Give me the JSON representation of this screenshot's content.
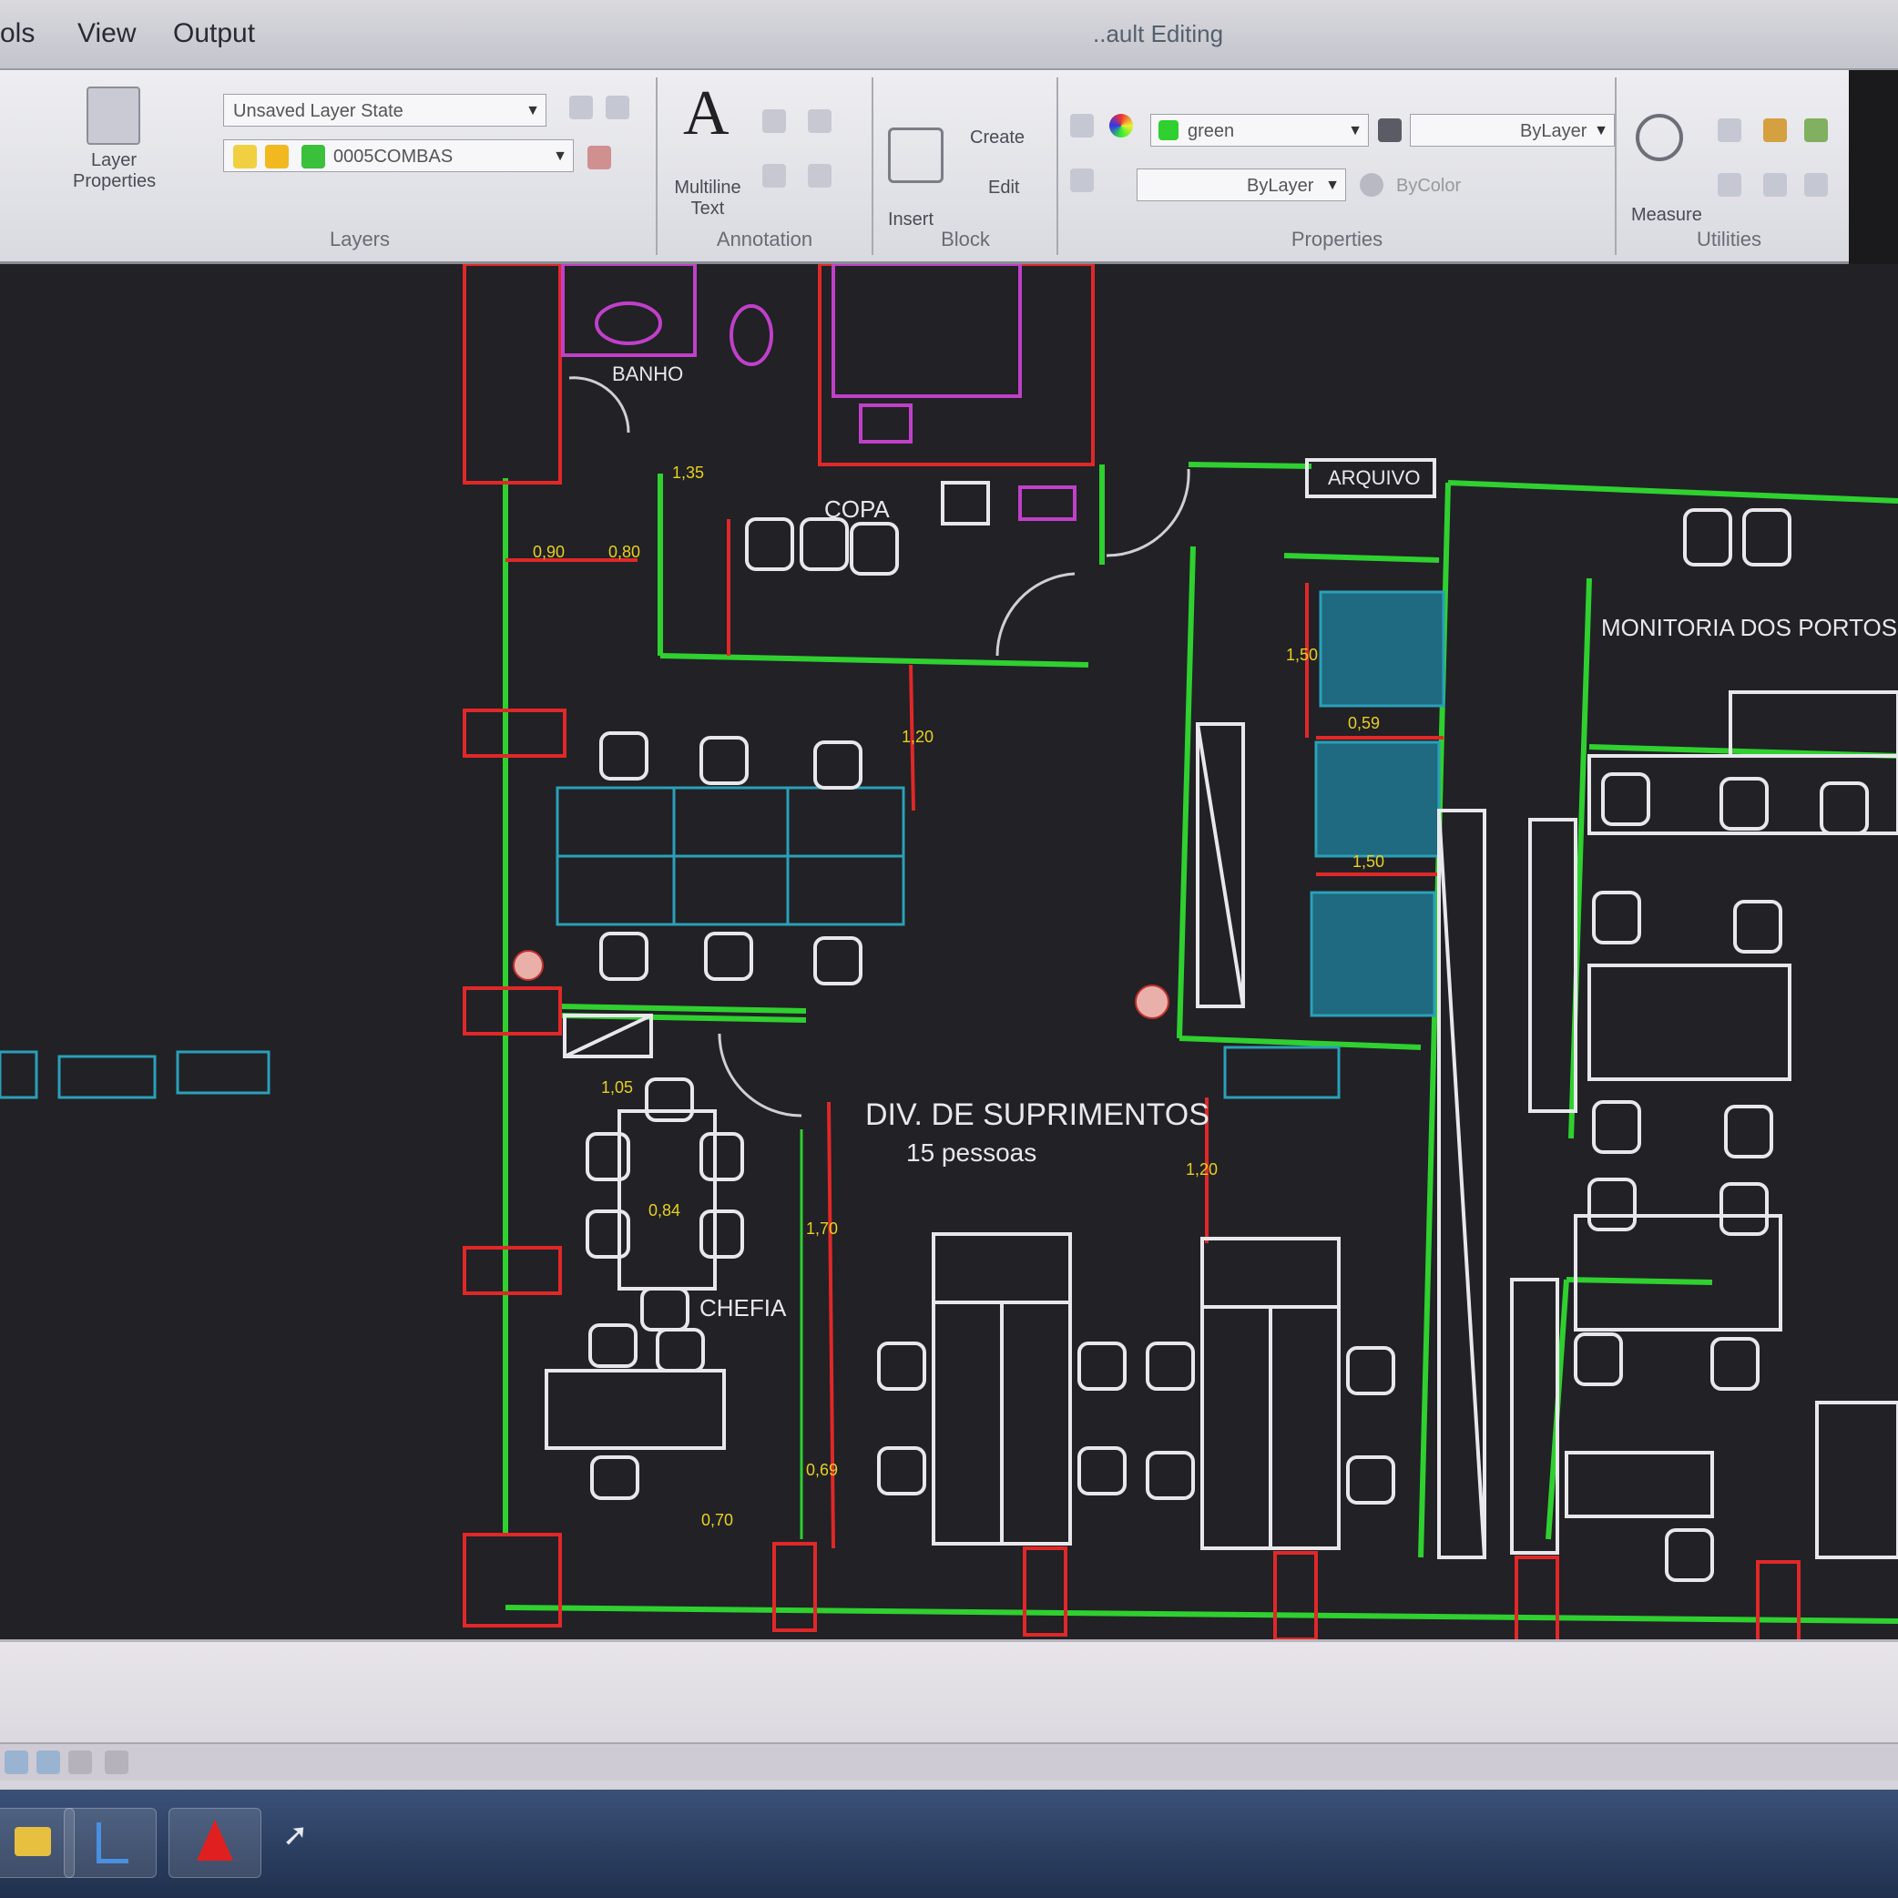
{
  "menu": {
    "items": [
      "ols",
      "View",
      "Output"
    ],
    "title": "..ault Editing"
  },
  "ribbon": {
    "layers": {
      "title": "Layers",
      "layer_state": "Unsaved Layer State",
      "current_layer": "0005COMBAS",
      "properties_label": "Layer Properties"
    },
    "annotation": {
      "title": "Annotation",
      "mtext_label": "Multiline Text"
    },
    "block": {
      "title": "Block",
      "insert_label": "Insert",
      "create_label": "Create",
      "edit_label": "Edit"
    },
    "properties": {
      "title": "Properties",
      "color": "green",
      "lineweight": "ByLayer",
      "linetype": "ByLayer",
      "plotstyle": "ByColor"
    },
    "utilities": {
      "title": "Utilities",
      "measure_label": "Measure"
    }
  },
  "drawing": {
    "labels": {
      "banho": "BANHO",
      "copa": "COPA",
      "monitoria": "MONITORIA DOS PORTOS",
      "div_suprimentos": "DIV. DE SUPRIMENTOS",
      "pessoas": "15 pessoas",
      "chefia": "CHEFIA",
      "arquivo": "ARQUIVO"
    },
    "dims": {
      "d1": "0,90",
      "d2": "0,80",
      "d3": "1,35",
      "d4": "1,20",
      "d5": "1,50",
      "d6": "0,84",
      "d7": "1,05",
      "d8": "0,70",
      "d9": "0,69",
      "d10": "1,20",
      "d11": "0,59",
      "d12": "1,70",
      "d13": "1,50"
    },
    "colors": {
      "wall": "#2fd02f",
      "column": "#e02828",
      "furniture": "#e8e8ec",
      "fixture": "#c040c8",
      "desk": "#2aa0b8",
      "dim": "#e8d020"
    }
  },
  "taskbar": {
    "items": [
      "folder-icon",
      "network-icon",
      "autocad-icon"
    ]
  }
}
